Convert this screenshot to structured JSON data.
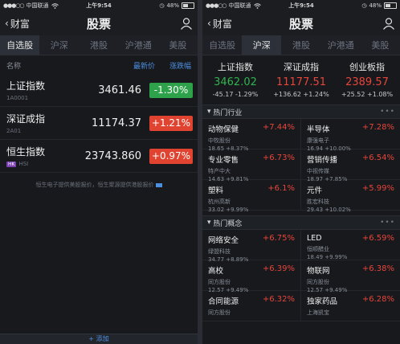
{
  "left": {
    "status": {
      "carrier": "中国联通",
      "time": "上午9:54",
      "battery": "48%"
    },
    "nav": {
      "back": "财富",
      "title": "股票"
    },
    "tabs": [
      "自选股",
      "沪深",
      "港股",
      "沪港通",
      "美股"
    ],
    "list_head": {
      "name": "名称",
      "price": "最新价",
      "change": "涨跌幅"
    },
    "rows": [
      {
        "name": "上证指数",
        "code": "1A0001",
        "price": "3461.46",
        "change": "-1.30%",
        "dir": "down"
      },
      {
        "name": "深证成指",
        "code": "2A01",
        "price": "11174.37",
        "change": "+1.21%",
        "dir": "up"
      },
      {
        "name": "恒生指数",
        "code": "HSI",
        "tag": "HK",
        "price": "23743.860",
        "change": "+0.97%",
        "dir": "up"
      }
    ],
    "note": "恒生电子提供美股报价，恒生聚源提供港股报价",
    "bottom": "+ 添加"
  },
  "right": {
    "status": {
      "carrier": "中国联通",
      "time": "上午9:54",
      "battery": "48%"
    },
    "nav": {
      "back": "财富",
      "title": "股票"
    },
    "tabs": [
      "自选股",
      "沪深",
      "港股",
      "沪港通",
      "美股"
    ],
    "indices": [
      {
        "name": "上证指数",
        "value": "3462.02",
        "detail": "-45.17 -1.29%",
        "dir": "down"
      },
      {
        "name": "深证成指",
        "value": "11177.51",
        "detail": "+136.62 +1.24%",
        "dir": "up"
      },
      {
        "name": "创业板指",
        "value": "2389.57",
        "detail": "+25.52 +1.08%",
        "dir": "up"
      }
    ],
    "sections": [
      {
        "title": "热门行业",
        "items": [
          {
            "name": "动物保健",
            "pct": "+7.44%",
            "lead": "中牧股份",
            "lv": "18.65 +8.37%"
          },
          {
            "name": "半导体",
            "pct": "+7.28%",
            "lead": "康强电子",
            "lv": "16.94 +10.00%"
          },
          {
            "name": "专业零售",
            "pct": "+6.73%",
            "lead": "特产中大",
            "lv": "14.63 +9.81%"
          },
          {
            "name": "营销传播",
            "pct": "+6.54%",
            "lead": "中视传媒",
            "lv": "18.97 +7.85%"
          },
          {
            "name": "塑料",
            "pct": "+6.1%",
            "lead": "杭州高新",
            "lv": "33.02 +9.99%"
          },
          {
            "name": "元件",
            "pct": "+5.99%",
            "lead": "胜宏科技",
            "lv": "29.43 +10.02%"
          }
        ]
      },
      {
        "title": "热门概念",
        "items": [
          {
            "name": "网络安全",
            "pct": "+6.75%",
            "lead": "绿盟科技",
            "lv": "34.77 +8.89%"
          },
          {
            "name": "LED",
            "pct": "+6.59%",
            "lead": "恒顺醋业",
            "lv": "18.49 +9.99%"
          },
          {
            "name": "高校",
            "pct": "+6.39%",
            "lead": "同方股份",
            "lv": "12.57 +9.49%"
          },
          {
            "name": "物联网",
            "pct": "+6.38%",
            "lead": "同方股份",
            "lv": "12.57 +9.49%"
          },
          {
            "name": "合同能源",
            "pct": "+6.32%",
            "lead": "同方股份",
            "lv": ""
          },
          {
            "name": "独家药品",
            "pct": "+6.28%",
            "lead": "上海凯宝",
            "lv": ""
          }
        ]
      }
    ]
  }
}
